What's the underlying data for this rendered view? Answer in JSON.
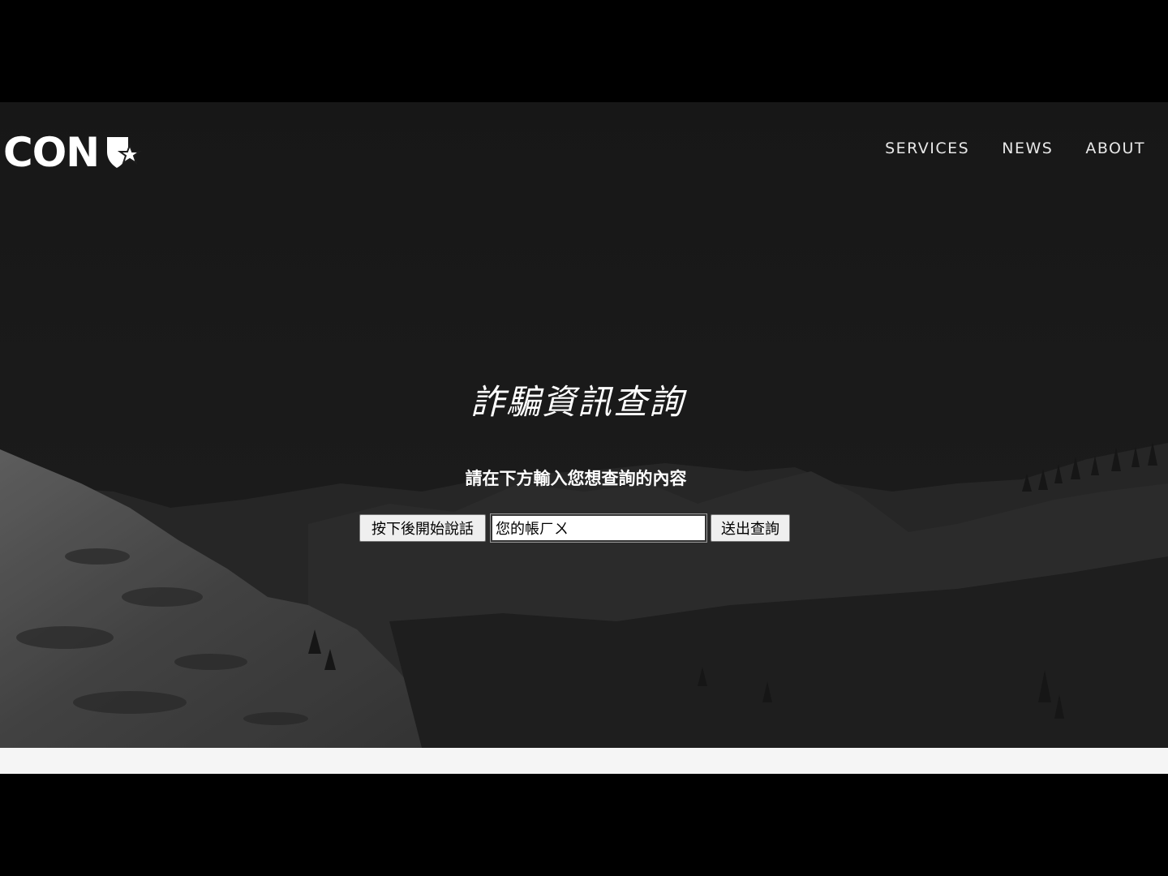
{
  "header": {
    "logo_text": ".CON",
    "nav": [
      {
        "label": "SERVICES"
      },
      {
        "label": "NEWS"
      },
      {
        "label": "ABOUT"
      }
    ]
  },
  "hero": {
    "title": "詐騙資訊查詢",
    "subtitle": "請在下方輸入您想查詢的內容",
    "speak_button_label": "按下後開始說話",
    "search_input_value": "您的帳ㄏㄨ",
    "submit_button_label": "送出查詢"
  },
  "icons": {
    "logo_icon": "shield-star-icon"
  },
  "colors": {
    "background": "#1d1d1d",
    "text": "#ffffff"
  }
}
